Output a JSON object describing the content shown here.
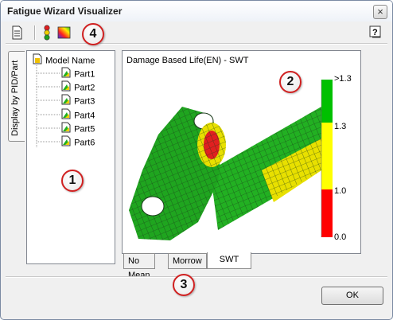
{
  "window": {
    "title": "Fatigue Wizard Visualizer",
    "close_glyph": "×"
  },
  "toolbar": {
    "buttons": [
      "document-icon",
      "traffic-light-icon",
      "color-palette-icon"
    ],
    "help_glyph": "?"
  },
  "side_tab": {
    "label": "Display by PID/Part"
  },
  "tree": {
    "root": "Model Name",
    "items": [
      "Part1",
      "Part2",
      "Part3",
      "Part4",
      "Part5",
      "Part6"
    ]
  },
  "viewer": {
    "title": "Damage Based Life(EN) - SWT",
    "legend": [
      {
        "label": ">1.3",
        "color": "#00c000"
      },
      {
        "label": "1.3",
        "color": "#ffff00"
      },
      {
        "label": "1.0",
        "color": "#ff0000"
      },
      {
        "label": "0.0",
        "color": "#ff0000"
      }
    ]
  },
  "tabs": [
    {
      "label": "No Mean",
      "active": false
    },
    {
      "label": "Morrow",
      "active": false
    },
    {
      "label": "SWT",
      "active": true
    }
  ],
  "callouts": [
    "1",
    "2",
    "3",
    "4"
  ],
  "ok_label": "OK"
}
